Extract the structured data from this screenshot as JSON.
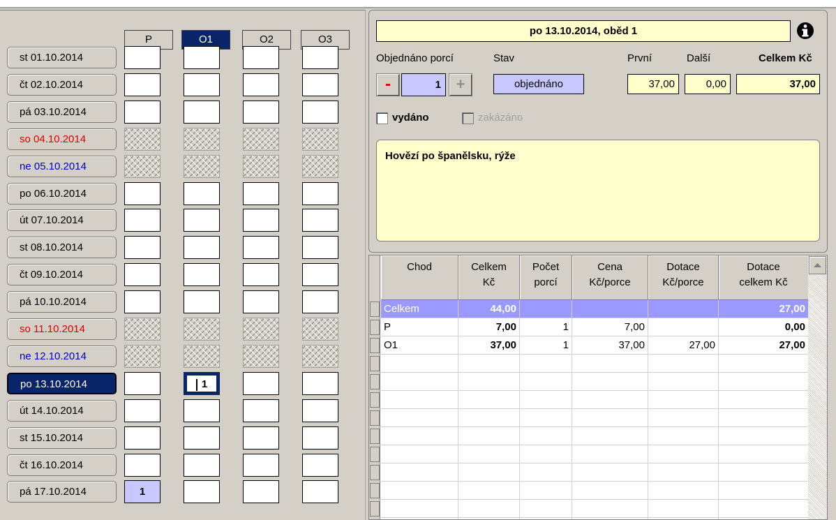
{
  "columns": [
    "P",
    "O1",
    "O2",
    "O3"
  ],
  "selected_column": "O1",
  "days": [
    {
      "label": "st 01.10.2014",
      "type": "normal",
      "cells": [
        "",
        "",
        "",
        ""
      ]
    },
    {
      "label": "čt 02.10.2014",
      "type": "normal",
      "cells": [
        "",
        "",
        "",
        ""
      ]
    },
    {
      "label": "pá 03.10.2014",
      "type": "normal",
      "cells": [
        "",
        "",
        "",
        ""
      ]
    },
    {
      "label": "so 04.10.2014",
      "type": "weekend-sat",
      "cells": [
        "",
        "",
        "",
        ""
      ]
    },
    {
      "label": "ne 05.10.2014",
      "type": "weekend-sun",
      "cells": [
        "",
        "",
        "",
        ""
      ]
    },
    {
      "label": "po 06.10.2014",
      "type": "normal",
      "cells": [
        "",
        "",
        "",
        ""
      ]
    },
    {
      "label": "út 07.10.2014",
      "type": "normal",
      "cells": [
        "",
        "",
        "",
        ""
      ]
    },
    {
      "label": "st 08.10.2014",
      "type": "normal",
      "cells": [
        "",
        "",
        "",
        ""
      ]
    },
    {
      "label": "čt 09.10.2014",
      "type": "normal",
      "cells": [
        "",
        "",
        "",
        ""
      ]
    },
    {
      "label": "pá 10.10.2014",
      "type": "normal",
      "cells": [
        "",
        "",
        "",
        ""
      ]
    },
    {
      "label": "so 11.10.2014",
      "type": "weekend-sat",
      "cells": [
        "",
        "",
        "",
        ""
      ]
    },
    {
      "label": "ne 12.10.2014",
      "type": "weekend-sun",
      "cells": [
        "",
        "",
        "",
        ""
      ]
    },
    {
      "label": "po 13.10.2014",
      "type": "selected",
      "cells": [
        "",
        "1",
        "",
        ""
      ]
    },
    {
      "label": "út 14.10.2014",
      "type": "normal",
      "cells": [
        "",
        "",
        "",
        ""
      ]
    },
    {
      "label": "st 15.10.2014",
      "type": "normal",
      "cells": [
        "",
        "",
        "",
        ""
      ]
    },
    {
      "label": "čt 16.10.2014",
      "type": "normal",
      "cells": [
        "",
        "",
        "",
        ""
      ]
    },
    {
      "label": "pá 17.10.2014",
      "type": "normal",
      "cells": [
        "1",
        "",
        "",
        ""
      ]
    }
  ],
  "detail": {
    "title": "po 13.10.2014, oběd 1",
    "ordered_label": "Objednáno porcí",
    "state_label": "Stav",
    "first_label": "První",
    "next_label": "Další",
    "total_label": "Celkem Kč",
    "minus_symbol": "-",
    "plus_symbol": "+",
    "portions": "1",
    "state": "objednáno",
    "first_price": "37,00",
    "next_price": "0,00",
    "total_price": "37,00",
    "issued_label": "vydáno",
    "forbidden_label": "zakázáno",
    "meal": "Hovězí po španělsku, rýže"
  },
  "grid": {
    "headers": [
      [
        "Chod"
      ],
      [
        "Celkem",
        "Kč"
      ],
      [
        "Počet",
        "porcí"
      ],
      [
        "Cena",
        "Kč/porce"
      ],
      [
        "Dotace",
        "Kč/porce"
      ],
      [
        "Dotace",
        "celkem Kč"
      ]
    ],
    "rows": [
      {
        "cells": [
          "Celkem",
          "44,00",
          "",
          "",
          "",
          "27,00"
        ],
        "highlight": true
      },
      {
        "cells": [
          "P",
          "7,00",
          "1",
          "7,00",
          "",
          "0,00"
        ],
        "highlight": false
      },
      {
        "cells": [
          "O1",
          "37,00",
          "1",
          "37,00",
          "27,00",
          "27,00"
        ],
        "highlight": false
      }
    ]
  },
  "colors": {
    "selection": "#0a246a",
    "highlight_row": "#9999ff",
    "yellow_field": "#ffffcc",
    "weekend_sat": "#e00000",
    "weekend_sun": "#0000c8"
  }
}
